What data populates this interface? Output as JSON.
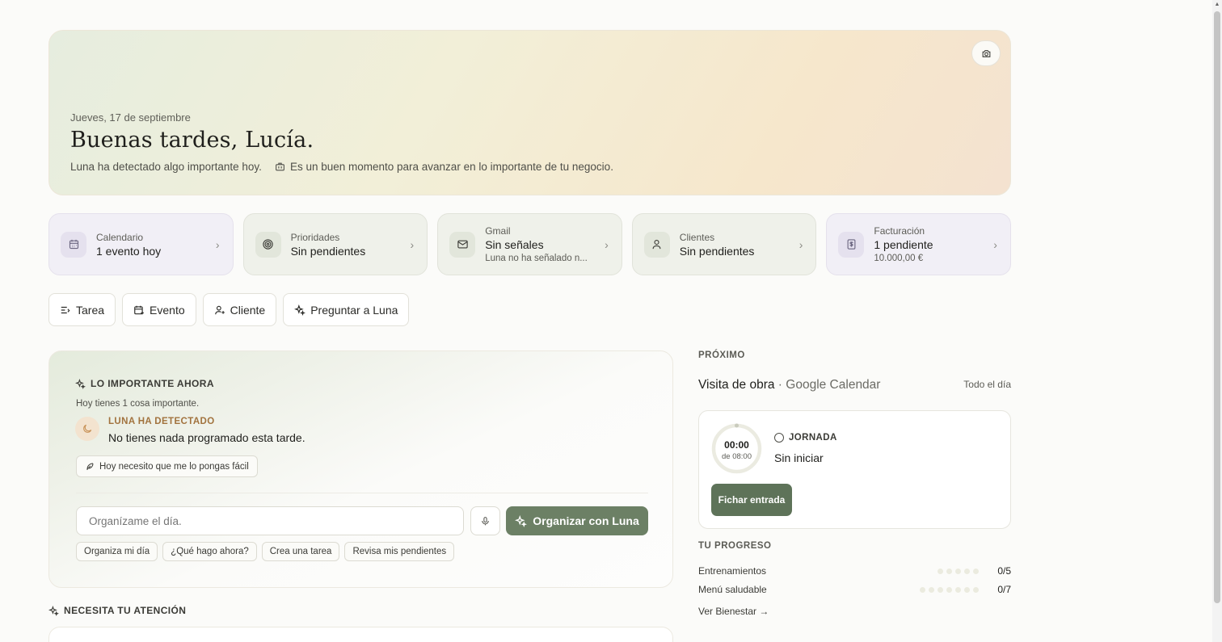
{
  "hero": {
    "date": "Jueves, 17 de septiembre",
    "greeting": "Buenas tardes, Lucía.",
    "detected": "Luna ha detectado algo importante hoy.",
    "message": "Es un buen momento para avanzar en lo importante de tu negocio."
  },
  "cards": [
    {
      "label": "Calendario",
      "value": "1 evento hoy",
      "extra": ""
    },
    {
      "label": "Prioridades",
      "value": "Sin pendientes",
      "extra": ""
    },
    {
      "label": "Gmail",
      "value": "Sin señales",
      "extra": "Luna no ha señalado n..."
    },
    {
      "label": "Clientes",
      "value": "Sin pendientes",
      "extra": ""
    },
    {
      "label": "Facturación",
      "value": "1 pendiente",
      "extra": "10.000,00 €"
    }
  ],
  "actions": {
    "task": "Tarea",
    "event": "Evento",
    "client": "Cliente",
    "ask": "Preguntar a Luna"
  },
  "important": {
    "heading": "LO IMPORTANTE AHORA",
    "count": "Hoy tienes 1 cosa importante.",
    "detected_label": "LUNA HA DETECTADO",
    "detected_msg": "No tienes nada programado esta tarde.",
    "need_chip": "Hoy necesito que me lo pongas fácil",
    "input_placeholder": "Organízame el día.",
    "organize_button": "Organizar con Luna",
    "suggestions": [
      "Organiza mi día",
      "¿Qué hago ahora?",
      "Crea una tarea",
      "Revisa mis pendientes"
    ]
  },
  "attention": {
    "heading": "NECESITA TU ATENCIÓN"
  },
  "next": {
    "heading": "PRÓXIMO",
    "event": "Visita de obra",
    "source": " · Google Calendar",
    "time": "Todo el día"
  },
  "jornada": {
    "time": "00:00",
    "of": "de 08:00",
    "label": "JORNADA",
    "state": "Sin iniciar",
    "button": "Fichar entrada"
  },
  "progress": {
    "heading": "TU PROGRESO",
    "items": [
      {
        "label": "Entrenamientos",
        "count": "0/5",
        "done": 0,
        "total": 5
      },
      {
        "label": "Menú saludable",
        "count": "0/7",
        "done": 0,
        "total": 7
      }
    ],
    "link": "Ver Bienestar →"
  },
  "colors": {
    "accent": "#6c8065",
    "fichar": "#5e7359",
    "detected": "#a2733e"
  }
}
